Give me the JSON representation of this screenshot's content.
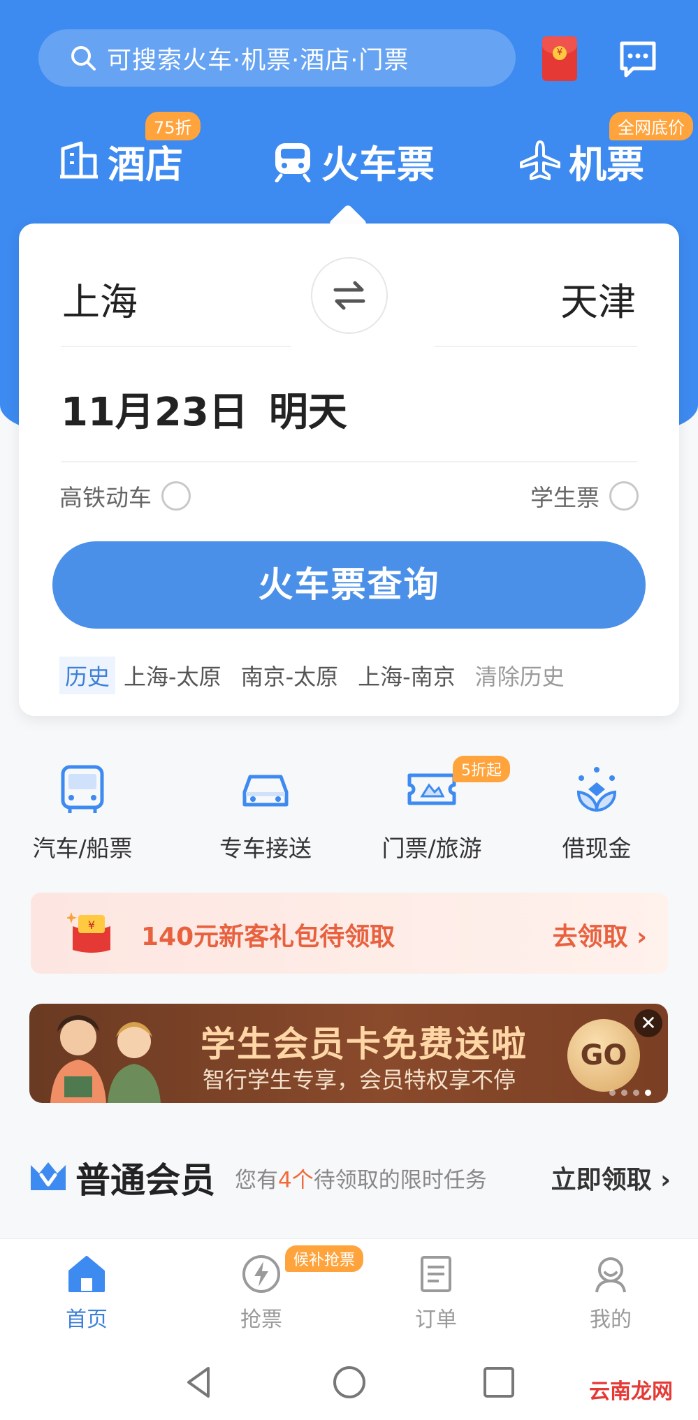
{
  "colors": {
    "brand_blue": "#3d8af0",
    "button_blue": "#4a8fe8",
    "badge_orange": "#ffa43d",
    "promo_red": "#e8613f",
    "highlight": "#f06a3a"
  },
  "header": {
    "search_placeholder": "可搜索火车·机票·酒店·门票",
    "redpacket_icon": "red-envelope-icon",
    "message_icon": "message-icon"
  },
  "tabs": [
    {
      "label": "酒店",
      "icon": "hotel-icon",
      "badge": "75折"
    },
    {
      "label": "火车票",
      "icon": "train-icon",
      "selected": true
    },
    {
      "label": "机票",
      "icon": "plane-icon",
      "badge": "全网底价"
    }
  ],
  "search_card": {
    "from_city": "上海",
    "to_city": "天津",
    "swap_icon": "swap-icon",
    "date": "11月23日",
    "date_sub": "明天",
    "option_highspeed": "高铁动车",
    "option_student": "学生票",
    "query_button": "火车票查询",
    "history_tag": "历史",
    "history_items": [
      "上海-太原",
      "南京-太原",
      "上海-南京"
    ],
    "history_clear": "清除历史"
  },
  "services": [
    {
      "label": "汽车/船票",
      "icon": "bus-icon"
    },
    {
      "label": "专车接送",
      "icon": "car-icon"
    },
    {
      "label": "门票/旅游",
      "icon": "ticket-icon",
      "badge": "5折起"
    },
    {
      "label": "借现金",
      "icon": "cash-icon"
    }
  ],
  "promo": {
    "text": "140元新客礼包待领取",
    "action": "去领取 ›"
  },
  "banner": {
    "title": "学生会员卡免费送啦",
    "subtitle": "智行学生专享，会员特权享不停",
    "go": "GO",
    "close": "✕"
  },
  "member": {
    "title": "普通会员",
    "desc_prefix": "您有",
    "desc_count": "4个",
    "desc_suffix": "待领取的限时任务",
    "action": "立即领取 ›"
  },
  "bottom_nav": [
    {
      "label": "首页",
      "icon": "home-icon",
      "active": true
    },
    {
      "label": "抢票",
      "icon": "lightning-icon",
      "badge": "候补抢票"
    },
    {
      "label": "订单",
      "icon": "order-icon"
    },
    {
      "label": "我的",
      "icon": "profile-icon"
    }
  ],
  "watermark": "云南龙网"
}
